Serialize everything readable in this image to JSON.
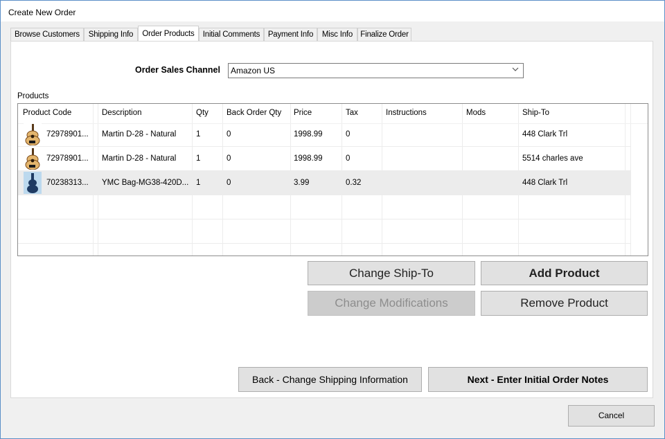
{
  "window": {
    "title": "Create New Order"
  },
  "tabs": [
    {
      "label": "Browse Customers"
    },
    {
      "label": "Shipping Info"
    },
    {
      "label": "Order Products"
    },
    {
      "label": "Initial Comments"
    },
    {
      "label": "Payment Info"
    },
    {
      "label": "Misc Info"
    },
    {
      "label": "Finalize Order"
    }
  ],
  "active_tab": "Order Products",
  "sales_channel": {
    "label": "Order Sales Channel",
    "value": "Amazon US"
  },
  "products": {
    "label": "Products",
    "columns": [
      "Product Code",
      "Description",
      "Qty",
      "Back Order Qty",
      "Price",
      "Tax",
      "Instructions",
      "Mods",
      "Ship-To"
    ],
    "rows": [
      {
        "code": "72978901...",
        "description": "Martin D-28 - Natural",
        "qty": "1",
        "back_order_qty": "0",
        "price": "1998.99",
        "tax": "0",
        "instructions": "",
        "mods": "",
        "ship_to": "448 Clark Trl",
        "icon": "guitar-icon"
      },
      {
        "code": "72978901...",
        "description": "Martin D-28 - Natural",
        "qty": "1",
        "back_order_qty": "0",
        "price": "1998.99",
        "tax": "0",
        "instructions": "",
        "mods": "",
        "ship_to": "5514 charles ave",
        "icon": "guitar-icon"
      },
      {
        "code": "70238313...",
        "description": "YMC Bag-MG38-420D...",
        "qty": "1",
        "back_order_qty": "0",
        "price": "3.99",
        "tax": "0.32",
        "instructions": "",
        "mods": "",
        "ship_to": "448 Clark Trl",
        "icon": "gig-bag-icon"
      }
    ]
  },
  "buttons": {
    "change_ship_to": "Change Ship-To",
    "add_product": "Add Product",
    "change_modifications": "Change Modifications",
    "remove_product": "Remove Product",
    "back": "Back - Change Shipping Information",
    "next": "Next - Enter Initial Order Notes",
    "cancel": "Cancel"
  },
  "colors": {
    "window_border": "#5b8fc7",
    "selected_row": "#ececec",
    "button_face": "#e1e1e1"
  }
}
